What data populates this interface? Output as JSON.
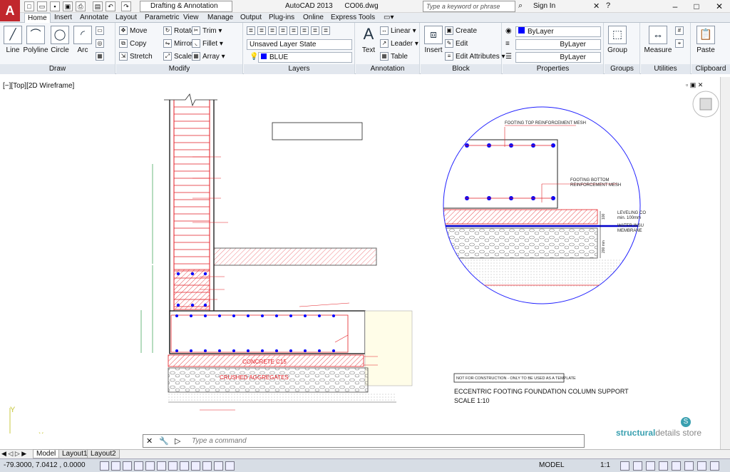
{
  "app": {
    "title_app": "AutoCAD 2013",
    "file": "CO06.dwg",
    "logo": "A",
    "workspace": "Drafting & Annotation",
    "search_placeholder": "Type a keyword or phrase",
    "sign_in": "Sign In"
  },
  "tabs": [
    "Home",
    "Insert",
    "Annotate",
    "Layout",
    "Parametric",
    "View",
    "Manage",
    "Output",
    "Plug-ins",
    "Online",
    "Express Tools"
  ],
  "draw": {
    "label": "Draw",
    "line": "Line",
    "polyline": "Polyline",
    "circle": "Circle",
    "arc": "Arc"
  },
  "modify": {
    "label": "Modify",
    "move": "Move",
    "rotate": "Rotate",
    "trim": "Trim",
    "copy": "Copy",
    "mirror": "Mirror",
    "fillet": "Fillet",
    "stretch": "Stretch",
    "scale": "Scale",
    "array": "Array"
  },
  "layers": {
    "label": "Layers",
    "state": "Unsaved Layer State",
    "current": "BLUE"
  },
  "annotation": {
    "label": "Annotation",
    "text": "Text",
    "linear": "Linear",
    "leader": "Leader",
    "table": "Table"
  },
  "block": {
    "label": "Block",
    "insert": "Insert",
    "create": "Create",
    "edit": "Edit",
    "edit_attributes": "Edit Attributes"
  },
  "properties": {
    "label": "Properties",
    "color": "ByLayer",
    "linetype": "ByLayer",
    "lineweight": "ByLayer"
  },
  "groups": {
    "label": "Groups",
    "group": "Group"
  },
  "utilities": {
    "label": "Utilities",
    "measure": "Measure"
  },
  "clipboard": {
    "label": "Clipboard",
    "paste": "Paste"
  },
  "viewport": {
    "label": "[−][Top][2D Wireframe]"
  },
  "drawing": {
    "concrete_label": "CONCRETE C15",
    "crushed_label": "CRUSHED AGGREGATES",
    "note": "NOT FOR CONSTRUCTION - ONLY TO BE USED AS A TEMPLATE",
    "title": "ECCENTRIC FOOTING FOUNDATION COLUMN SUPPORT",
    "scale": "SCALE 1:10",
    "detail_top_mesh": "FOOTING TOP REINFORCEMENT MESH",
    "detail_bottom_mesh_1": "FOOTING BOTTOM",
    "detail_bottom_mesh_2": "REINFORCEMENT MESH",
    "detail_leveling_1": "LEVELING CO",
    "detail_leveling_2": "min. 100mm",
    "detail_water_1": "WATER INSU",
    "detail_water_2": "MEMBRANE",
    "detail_dim_100": "100",
    "detail_dim_200": "200 min"
  },
  "brand": {
    "part1": "structural",
    "part2": "details store",
    "logo": "S"
  },
  "command": {
    "placeholder": "Type a command"
  },
  "layout_tabs": [
    "Model",
    "Layout1",
    "Layout2"
  ],
  "status": {
    "coords": "-79.3000, 7.0412 , 0.0000",
    "model": "MODEL",
    "scale": "1:1"
  },
  "colors": {
    "accent_red": "#c1272d",
    "drawing_red": "#e31e24",
    "blue": "#0000ff",
    "hatch": "#ff6666"
  }
}
